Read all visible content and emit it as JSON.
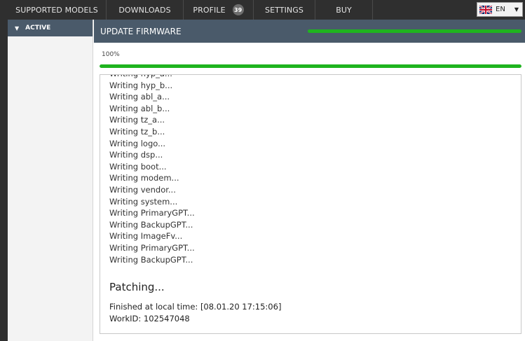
{
  "nav": {
    "items": [
      {
        "label": "SUPPORTED MODELS"
      },
      {
        "label": "DOWNLOADS"
      },
      {
        "label": "PROFILE",
        "badge": "39"
      },
      {
        "label": "SETTINGS"
      },
      {
        "label": "BUY"
      }
    ],
    "language": {
      "flag_icon": "uk-flag-icon",
      "code": "EN"
    }
  },
  "sidebar": {
    "active_label": "ACTIVE"
  },
  "panel": {
    "title": "UPDATE FIRMWARE",
    "progress_text": "100%",
    "progress_value": 1.0,
    "progress_color": "#1fb41f"
  },
  "log": {
    "lines": [
      "Writing hyp_a...",
      "Writing hyp_b...",
      "Writing abl_a...",
      "Writing abl_b...",
      "Writing tz_a...",
      "Writing tz_b...",
      "Writing logo...",
      "Writing dsp...",
      "Writing boot...",
      "Writing modem...",
      "Writing vendor...",
      "Writing system...",
      "Writing PrimaryGPT...",
      "Writing BackupGPT...",
      "Writing ImageFv...",
      "Writing PrimaryGPT...",
      "Writing BackupGPT..."
    ],
    "status": "Patching...",
    "finished": "Finished at local time: [08.01.20 17:15:06]",
    "workid": "WorkID: 102547048"
  }
}
